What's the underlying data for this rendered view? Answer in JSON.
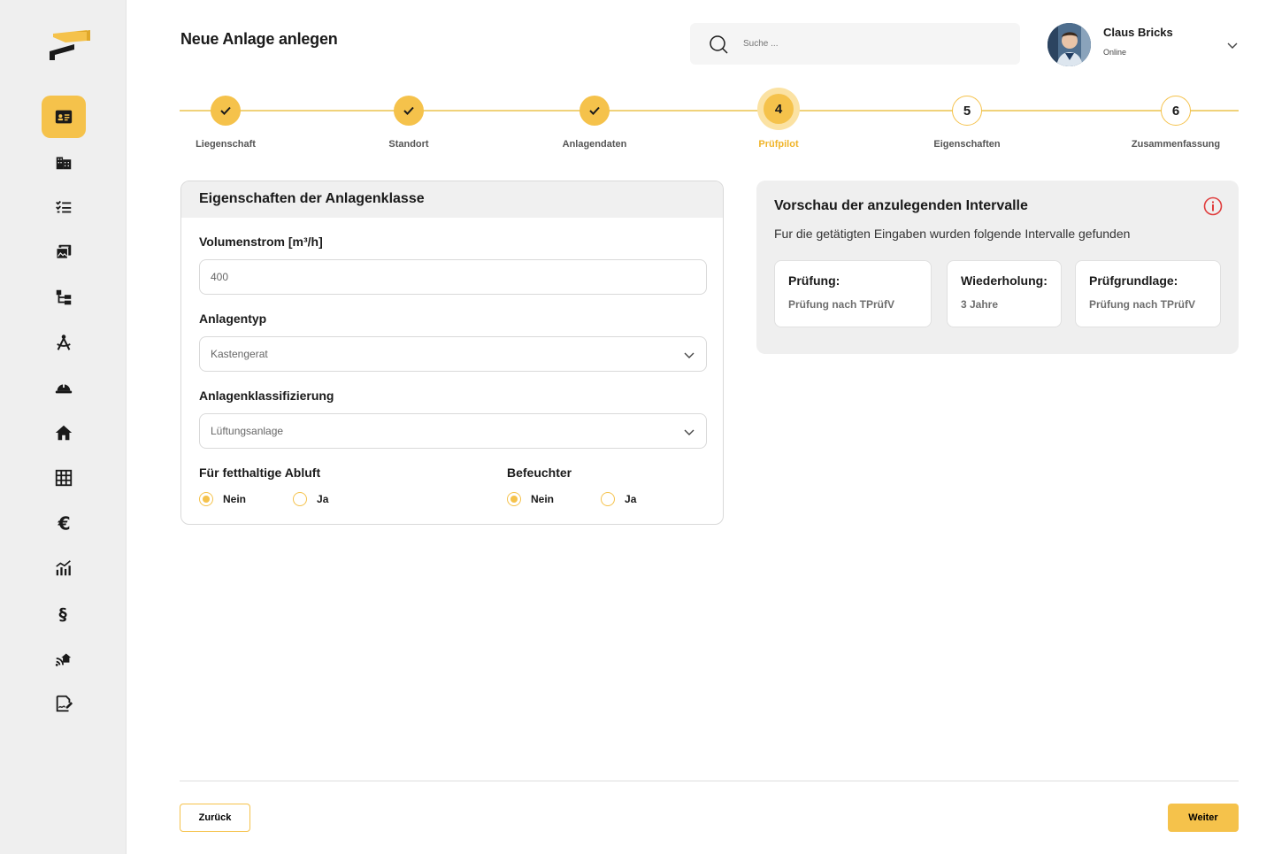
{
  "header": {
    "title": "Neue Anlage anlegen",
    "search_placeholder": "Suche ..."
  },
  "user": {
    "name": "Claus Bricks",
    "status": "Online"
  },
  "sidebar": {
    "items": [
      {
        "icon": "id-card-icon",
        "active": true
      },
      {
        "icon": "buildings-icon",
        "active": false
      },
      {
        "icon": "checklist-icon",
        "active": false
      },
      {
        "icon": "documents-icon",
        "active": false
      },
      {
        "icon": "hierarchy-icon",
        "active": false
      },
      {
        "icon": "compass-icon",
        "active": false
      },
      {
        "icon": "helmet-icon",
        "active": false
      },
      {
        "icon": "home-icon",
        "active": false
      },
      {
        "icon": "calendar-grid-icon",
        "active": false
      },
      {
        "icon": "euro-icon",
        "active": false
      },
      {
        "icon": "chart-icon",
        "active": false
      },
      {
        "icon": "paragraph-icon",
        "active": false
      },
      {
        "icon": "smart-home-icon",
        "active": false
      },
      {
        "icon": "signature-icon",
        "active": false
      }
    ]
  },
  "stepper": {
    "steps": [
      {
        "number": "1",
        "label": "Liegenschaft",
        "state": "done"
      },
      {
        "number": "2",
        "label": "Standort",
        "state": "done"
      },
      {
        "number": "3",
        "label": "Anlagendaten",
        "state": "done"
      },
      {
        "number": "4",
        "label": "Prüfpilot",
        "state": "current"
      },
      {
        "number": "5",
        "label": "Eigenschaften",
        "state": "todo"
      },
      {
        "number": "6",
        "label": "Zusammenfassung",
        "state": "todo"
      }
    ]
  },
  "form": {
    "title": "Eigenschaften der Anlagenklasse",
    "volumenstrom_label": "Volumenstrom [m³/h]",
    "volumenstrom_value": "400",
    "anlagentyp_label": "Anlagentyp",
    "anlagentyp_value": "Kastengerat",
    "klassifizierung_label": "Anlagenklassifizierung",
    "klassifizierung_value": "Lüftungsanlage",
    "abluft_label": "Für fetthaltige Abluft",
    "abluft_options": [
      "Nein",
      "Ja"
    ],
    "abluft_selected": "Nein",
    "befeuchter_label": "Befeuchter",
    "befeuchter_options": [
      "Nein",
      "Ja"
    ],
    "befeuchter_selected": "Nein"
  },
  "preview": {
    "title": "Vorschau der anzulegenden Intervalle",
    "subtitle": "Fur die getätigten Eingaben wurden folgende Intervalle gefunden",
    "tiles": [
      {
        "title": "Prüfung:",
        "value": "Prüfung nach TPrüfV"
      },
      {
        "title": "Wiederholung:",
        "value": "3 Jahre"
      },
      {
        "title": "Prüfgrundlage:",
        "value": "Prüfung nach TPrüfV"
      }
    ]
  },
  "footer": {
    "back_label": "Zurück",
    "next_label": "Weiter"
  },
  "colors": {
    "accent": "#f5c24b",
    "accent_light": "#fbe2a3",
    "sidebar_bg": "#efefef",
    "error_icon": "#e03c3c"
  }
}
